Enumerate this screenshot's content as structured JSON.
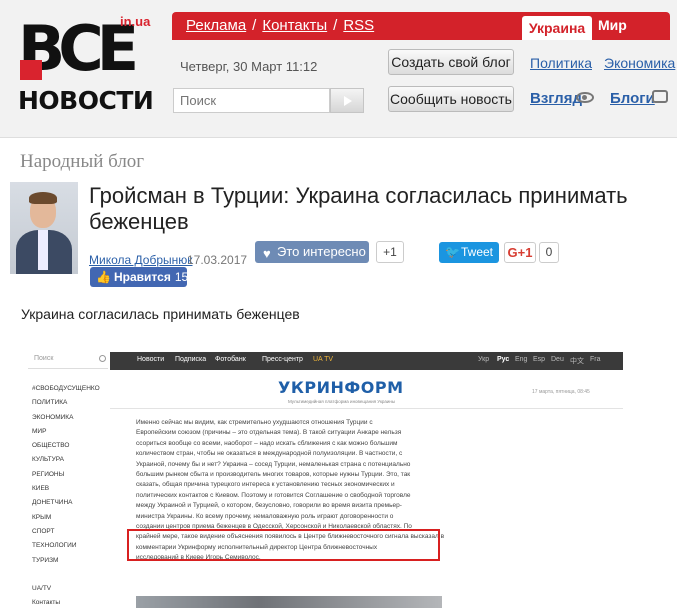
{
  "logo": {
    "main": "ВСЕ",
    "tld": "in.ua",
    "sub": "НОВОСТИ"
  },
  "topbar": {
    "links": [
      "Реклама",
      "Контакты",
      "RSS"
    ],
    "separator": "/",
    "tab_active": "Украина",
    "tab_other": "Мир"
  },
  "header": {
    "date": "Четверг, 30 Март 11:12",
    "create_blog_label": "Создать свой блог",
    "report_news_label": "Сообщить новость",
    "search_placeholder": "Поиск",
    "links": {
      "politics": "Политика",
      "economy": "Экономика",
      "opinion": "Взгляд",
      "blogs": "Блоги"
    }
  },
  "article": {
    "section": "Народный блог",
    "title": "Гройсман в Турции: Украина согласилась принимать беженцев",
    "author": "Микола Добрынюк",
    "date": "17.03.2017",
    "interesting_label": "Это интересно",
    "interesting_count": "+1",
    "tweet_label": "Tweet",
    "gplus_label": "G+1",
    "gplus_count": "0",
    "fb_label": "Нравится",
    "fb_count": "15",
    "lead": "Украина согласилась принимать беженцев"
  },
  "embedded": {
    "search_placeholder": "Поиск",
    "sidebar": [
      "#СВОБОДУСУЩЕНКО",
      "ПОЛИТИКА",
      "ЭКОНОМИКА",
      "МИР",
      "ОБЩЕСТВО",
      "КУЛЬТУРА",
      "РЕГИОНЫ",
      "КИЕВ",
      "ДОНЕТЧИНА",
      "КРЫМ",
      "СПОРТ",
      "ТЕХНОЛОГИИ",
      "ТУРИЗМ",
      "",
      "UA/TV",
      "Контакты"
    ],
    "nav": [
      "Новости",
      "Подписка",
      "Фотобанк",
      "Пресс-центр",
      "UA TV"
    ],
    "langs": [
      "Укр",
      "Рус",
      "Eng",
      "Esp",
      "Deu",
      "中文",
      "Fra"
    ],
    "active_lang": "Рус",
    "logo": "УКРИНФОРМ",
    "logo_sub": "Мультимедийная платформа иновещания Украины",
    "date": "17 марта, пятница, 08:45",
    "paragraph": [
      "Именно сейчас мы видим, как стремительно ухудшаются отношения Турции с",
      "Европейским союзом (причины – это отдельная тема). В такой ситуации Анкаре нельзя",
      "ссориться вообще со всеми, наоборот – надо искать сближения с как можно большим",
      "количеством стран, чтобы не оказаться в международной полуизоляции. В частности, с",
      "Украиной, почему бы и нет? Украина – сосед Турции, немаленькая страна с потенциально",
      "большим рынком сбыта и производитель многих товаров, которые нужны Турции. Это, так",
      "сказать, общая причина турецкого интереса к установлению тесных экономических и",
      "политических контактов с Киевом. Поэтому и готовится Соглашение о свободной торговле",
      "между Украиной и Турцией, о котором, безусловно, говорили во время визита премьер-",
      "министра Украины. Ко всему прочему, немаловажную роль играют договоренности о",
      "создании центров приема беженцев в Одесской, Херсонской и Николаевской областях. По",
      "крайней мере, такое видение объяснения появилось в Центре ближневосточного сигнала высказал в",
      "комментарии Укринформу исполнительный директор Центра ближневосточных",
      "исследований в Киеве Игорь Семиволос."
    ]
  }
}
